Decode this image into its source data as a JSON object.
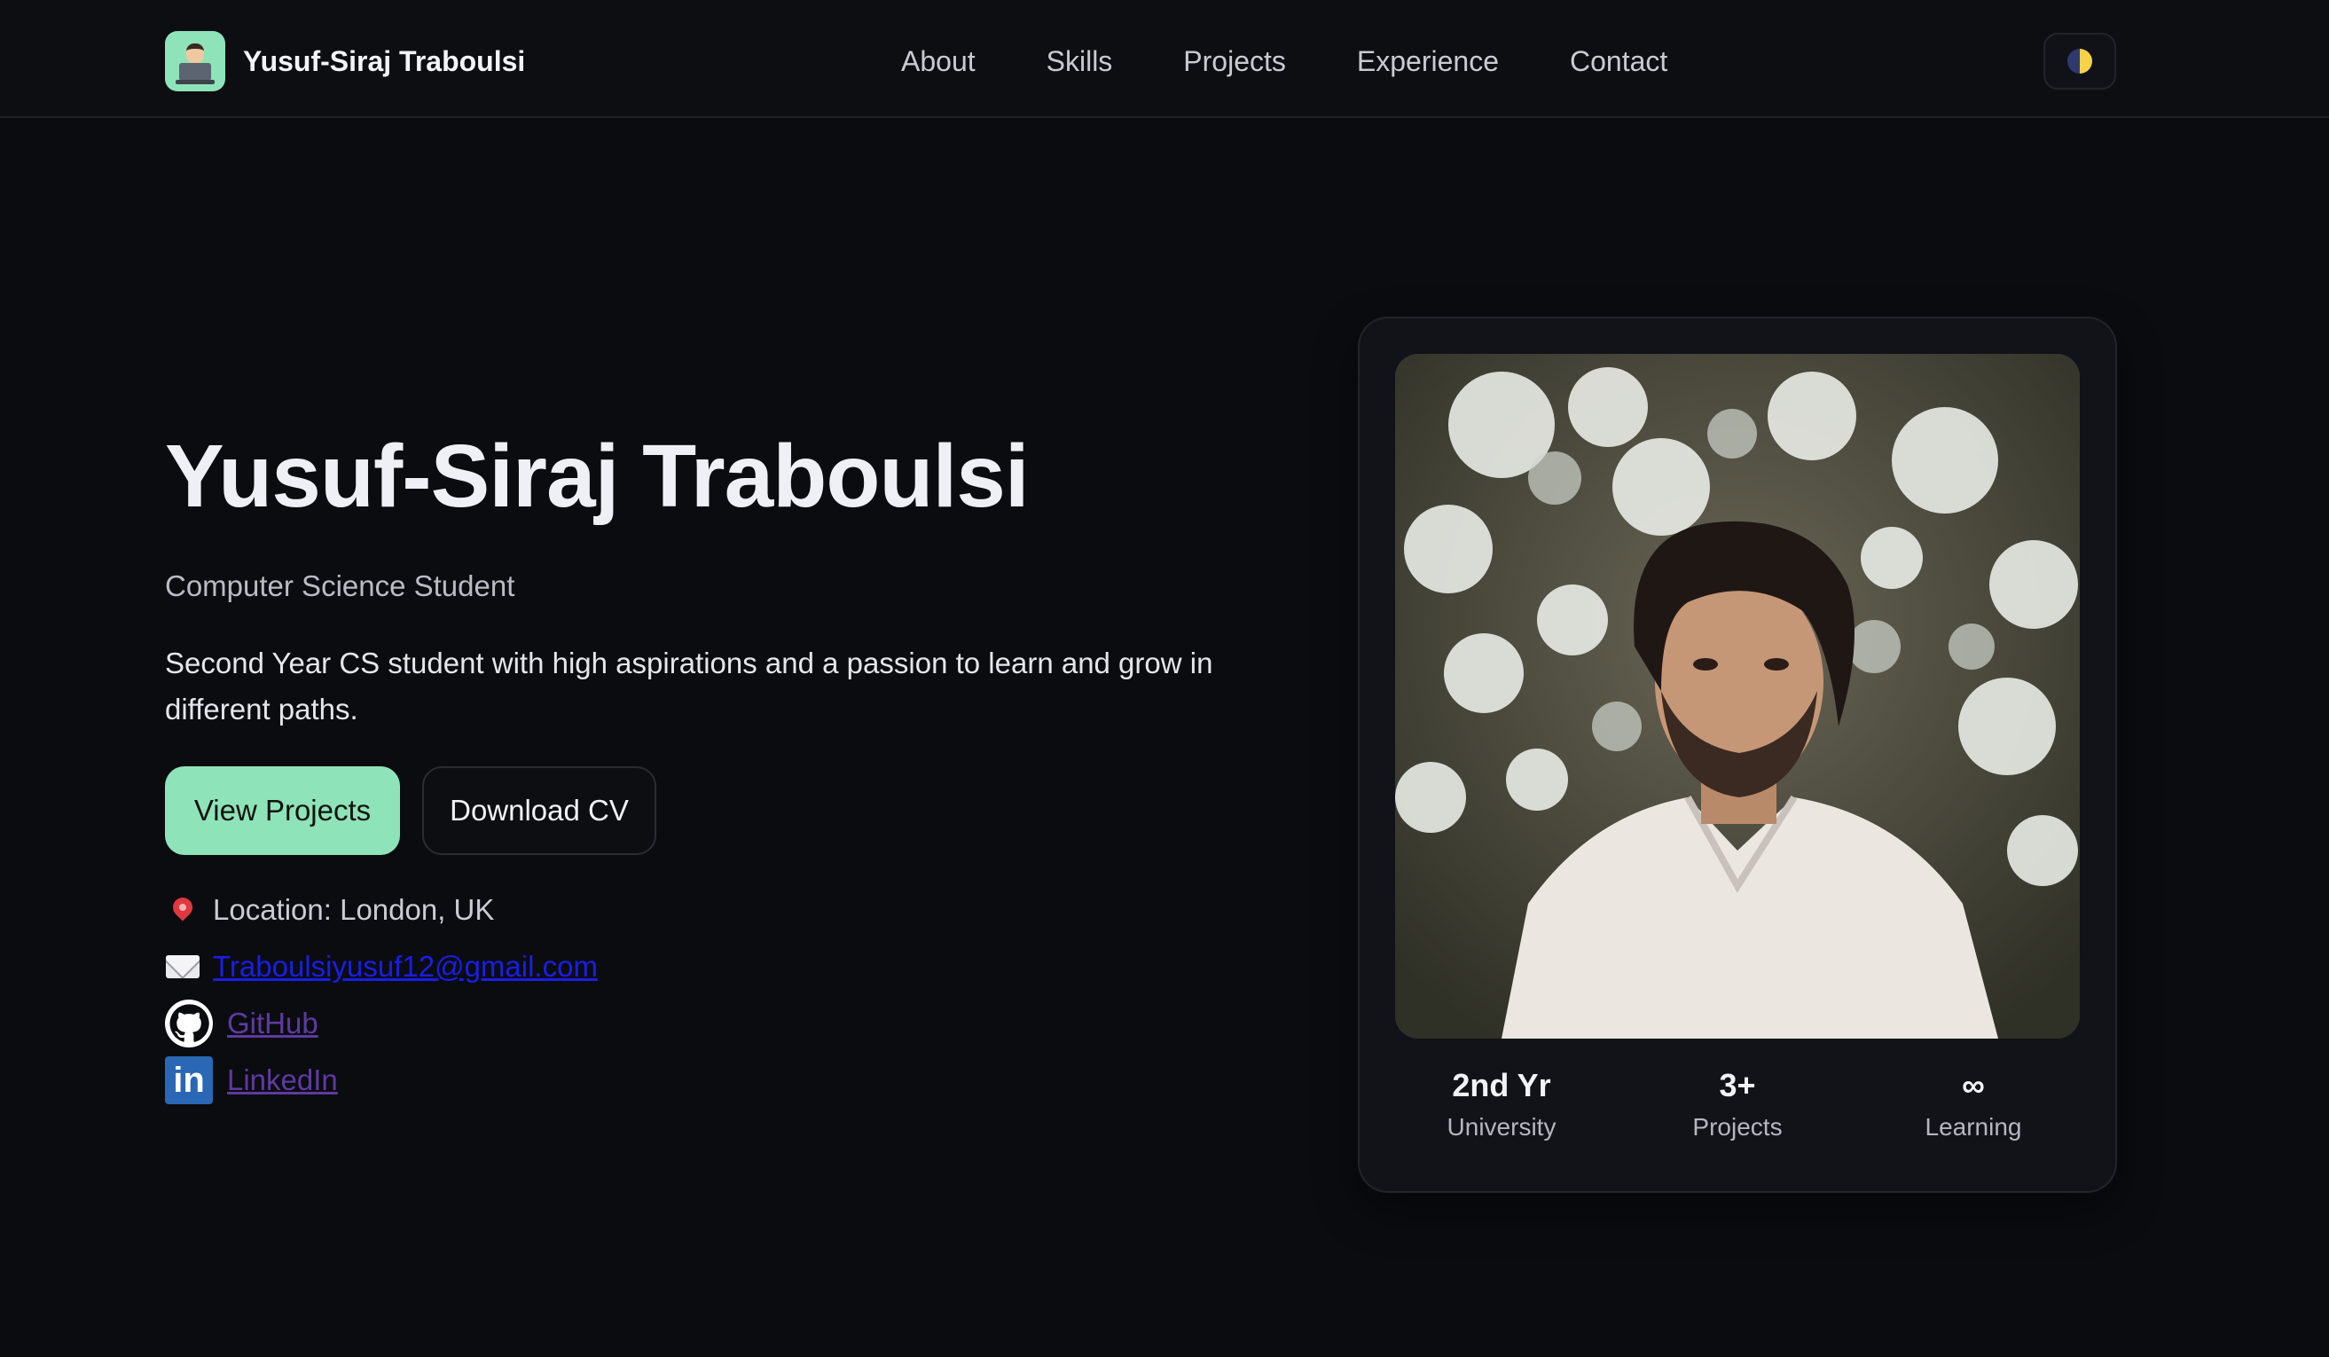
{
  "nav": {
    "brand_name": "Yusuf-Siraj Traboulsi",
    "links": [
      {
        "label": "About"
      },
      {
        "label": "Skills"
      },
      {
        "label": "Projects"
      },
      {
        "label": "Experience"
      },
      {
        "label": "Contact"
      }
    ],
    "theme_toggle_icon": "half-moon-icon"
  },
  "hero": {
    "title": "Yusuf-Siraj Traboulsi",
    "subtitle": "Computer Science Student",
    "description": "Second Year CS student with high aspirations and a passion to learn and grow in different paths.",
    "primary_button": "View Projects",
    "secondary_button": "Download CV"
  },
  "contact": {
    "location": "Location: London, UK",
    "email": "Traboulsiyusuf12@gmail.com",
    "github": "GitHub",
    "linkedin": "LinkedIn"
  },
  "profile_card": {
    "stats": [
      {
        "value": "2nd Yr",
        "label": "University"
      },
      {
        "value": "3+",
        "label": "Projects"
      },
      {
        "value": "∞",
        "label": "Learning"
      }
    ]
  },
  "colors": {
    "background": "#0b0c10",
    "accent": "#8fe3b8",
    "card": "#121318",
    "email_link": "#1a1ee6",
    "visited_link": "#5e3aa0"
  }
}
